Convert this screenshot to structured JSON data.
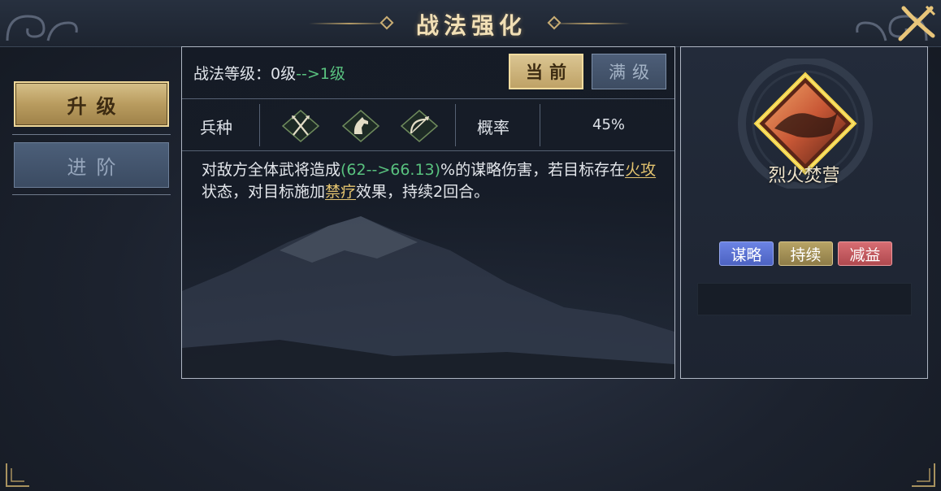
{
  "header": {
    "title": "战法强化"
  },
  "nav": {
    "upgrade_label": "升级",
    "advance_label": "进阶"
  },
  "level": {
    "label": "战法等级：",
    "current": "0级",
    "arrow_next": "-->1级"
  },
  "tabs": {
    "current_label": "当前",
    "max_label": "满级"
  },
  "troops": {
    "label": "兵种",
    "icons": [
      "spear-icon",
      "cavalry-horse-icon",
      "bow-icon"
    ],
    "rate_label": "概率",
    "rate_value": "45%"
  },
  "description": {
    "part1": "对敌方全体武将造成",
    "damage": "(62-->66.13)",
    "part2": "%的谋略伤害，若目标存在",
    "keyword1": "火攻",
    "part3": "状态，对目标施加",
    "keyword2": "禁疗",
    "part4": "效果，持续2回合。"
  },
  "skill": {
    "name": "烈火焚营",
    "tags": [
      "谋略",
      "持续",
      "减益"
    ]
  },
  "colors": {
    "gold": "#d6c089",
    "green": "#59c27f",
    "keyword": "#e3c36f",
    "tag_strategy": "#5a72d4",
    "tag_duration": "#a49152",
    "tag_debuff": "#c65a60"
  }
}
